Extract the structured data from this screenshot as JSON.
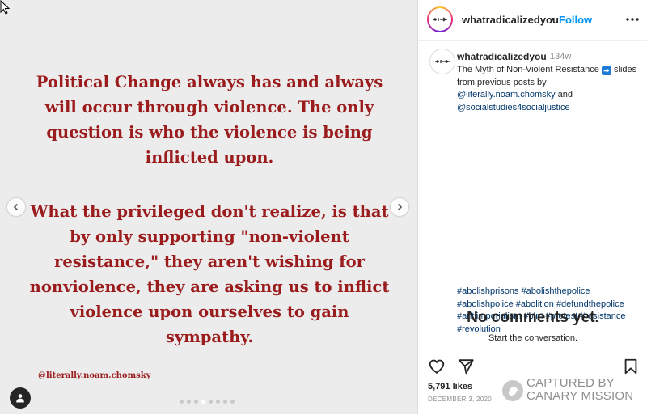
{
  "post": {
    "quote_first": "Political Change always has and always will occur through violence. The only question is who the violence is being inflicted upon.",
    "quote_second": "What the privileged don't realize, is that by only supporting \"non-violent resistance,\" they aren't wishing for nonviolence, they are asking us to inflict violence upon ourselves to gain sympathy.",
    "credit": "@literally.noam.chomsky",
    "carousel": {
      "total_slides": 8,
      "active_index": 3
    }
  },
  "header": {
    "username": "whatradicalizedyou",
    "separator": "•",
    "follow_label": "Follow"
  },
  "caption": {
    "username": "whatradicalizedyou",
    "time_ago": "134w",
    "text_before": "The Myth of Non-Violent Resistance",
    "text_after": "slides from previous posts by",
    "mention_1": "@literally.noam.chomsky",
    "and_word": "and",
    "mention_2": "@socialstudies4socialjustice",
    "hashtags": [
      "#abolishprisons",
      "#abolishthepolice",
      "#abolishpolice",
      "#abolition",
      "#defundthepolice",
      "#antiimperialism",
      "#blm",
      "#protest",
      "#resistance",
      "#revolution"
    ]
  },
  "comments": {
    "empty_title": "No comments yet.",
    "empty_subtitle": "Start the conversation."
  },
  "footer": {
    "likes": "5,791 likes",
    "date": "DECEMBER 3, 2020"
  },
  "watermark": {
    "line1": "CAPTURED BY",
    "line2": "CANARY MISSION"
  },
  "icons": {
    "arrow_box": "➡",
    "prev": "chevron-left-icon",
    "next": "chevron-right-icon",
    "more": "more-horizontal-icon",
    "like": "heart-icon",
    "share": "send-icon",
    "save": "bookmark-icon",
    "tag": "user-tag-icon"
  },
  "colors": {
    "quote_text": "#9b1c1c",
    "link": "#00376b",
    "follow": "#0095f6"
  }
}
